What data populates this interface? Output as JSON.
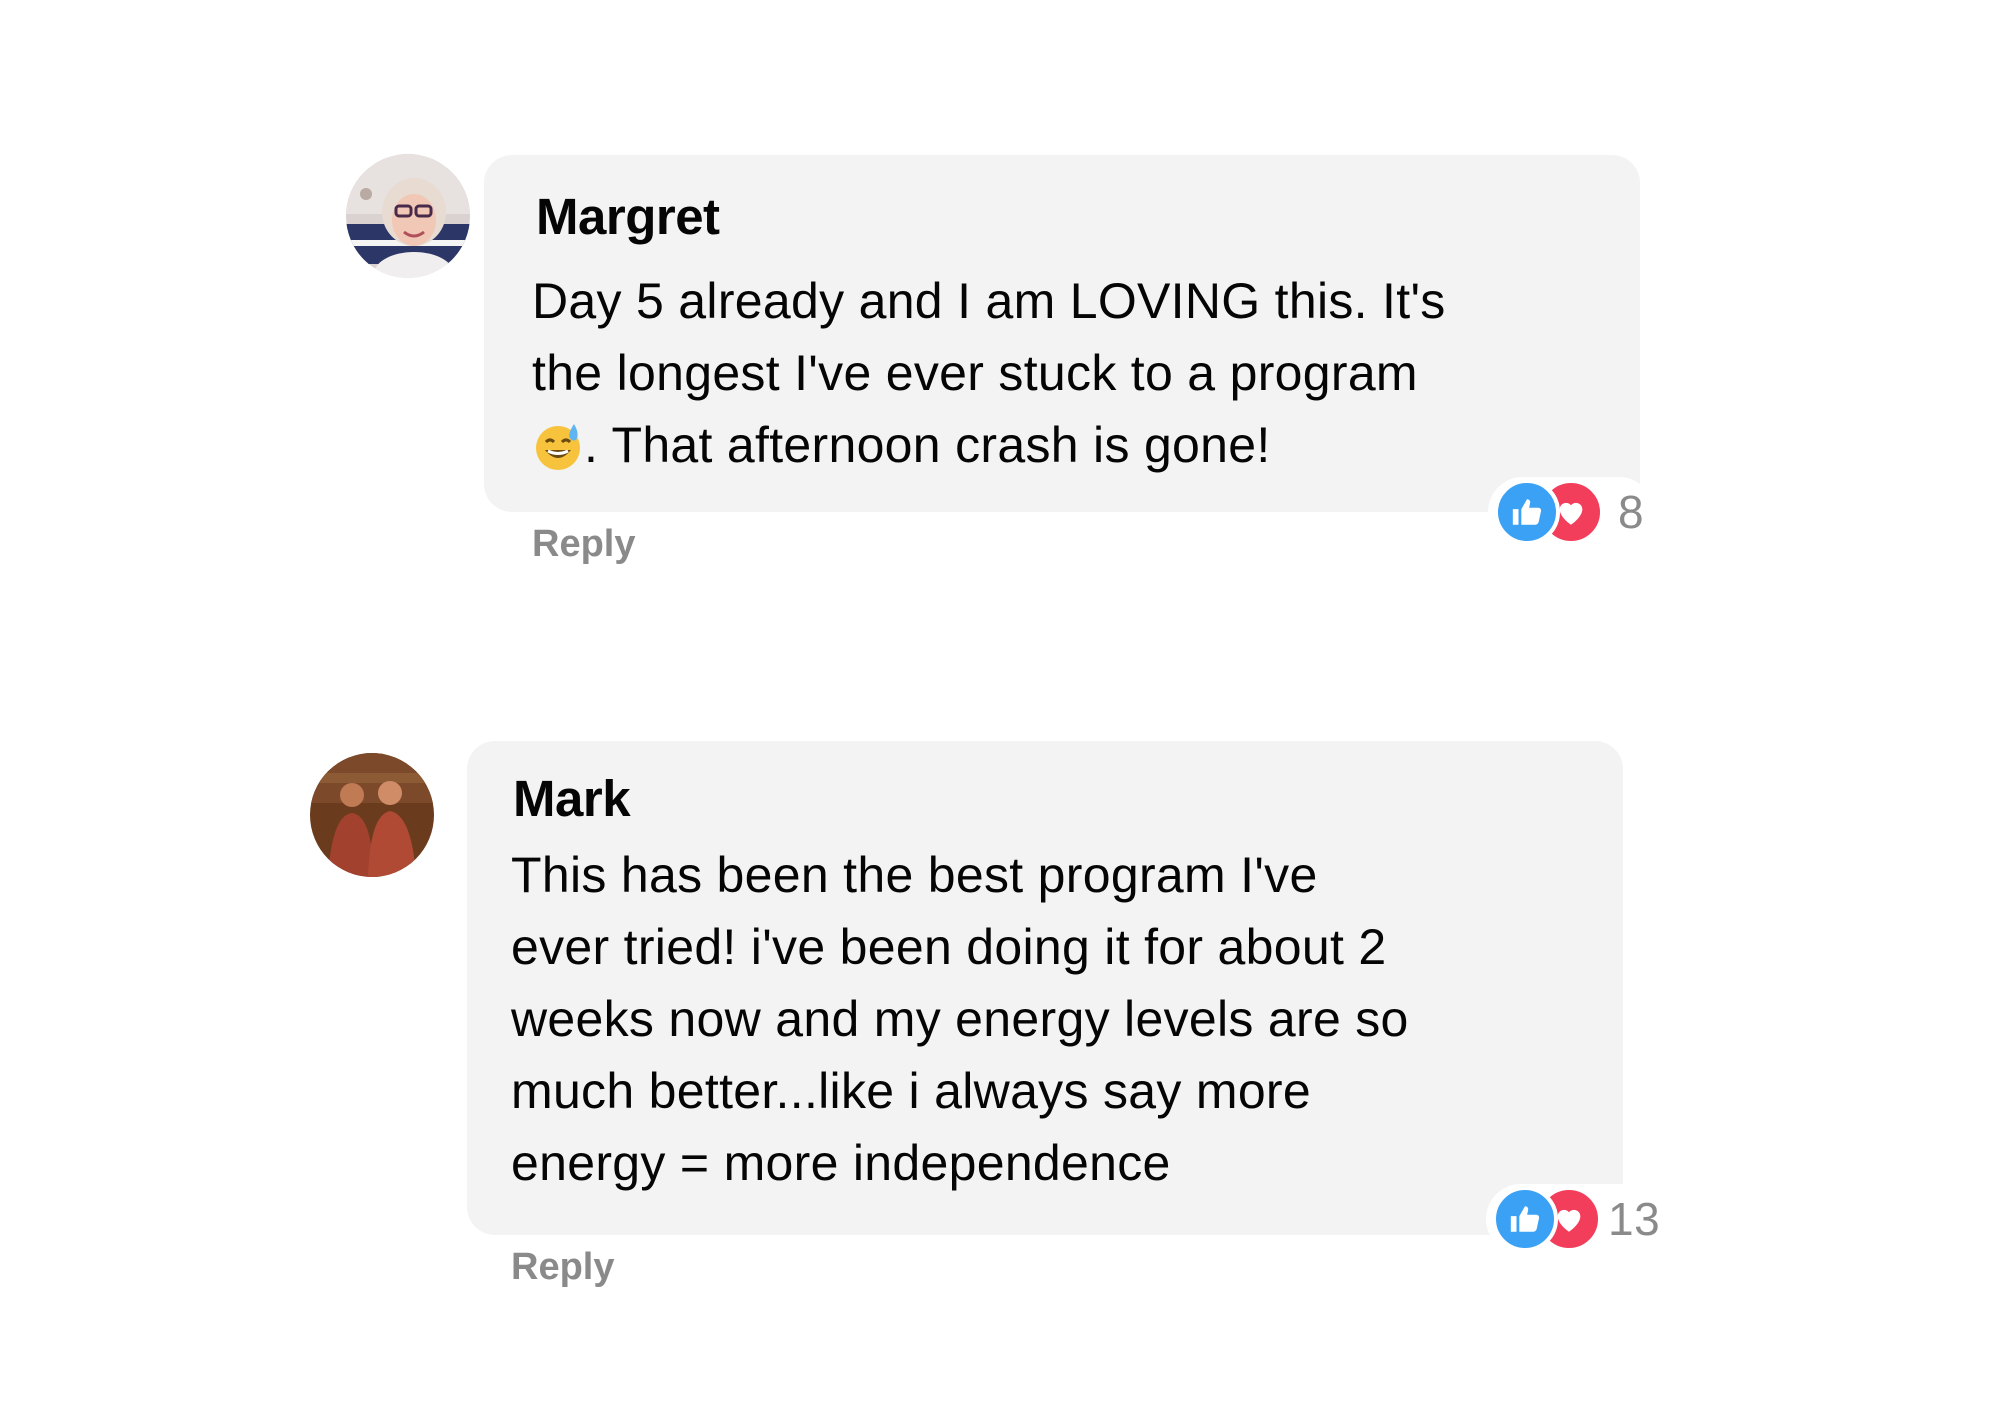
{
  "comments": [
    {
      "author": "Margret",
      "lines": [
        "Day 5 already and I am LOVING this. It's",
        "the longest I've ever stuck to a program",
        ". That afternoon crash is gone!"
      ],
      "emoji": "sweat-smile-emoji",
      "reply_label": "Reply",
      "reaction_icons": [
        "like-icon",
        "love-icon"
      ],
      "reaction_count": "8"
    },
    {
      "author": "Mark",
      "lines": [
        "This has been the best program I've",
        "ever tried! i've been doing it for about 2",
        "weeks now and my energy levels are so",
        "much better...like i always say more",
        "energy = more independence"
      ],
      "reply_label": "Reply",
      "reaction_icons": [
        "like-icon",
        "love-icon"
      ],
      "reaction_count": "13"
    }
  ],
  "colors": {
    "bubble_bg": "#f3f3f3",
    "like_blue": "#3aa1f5",
    "love_red": "#f33e5b",
    "muted_text": "#8a8a8a"
  }
}
